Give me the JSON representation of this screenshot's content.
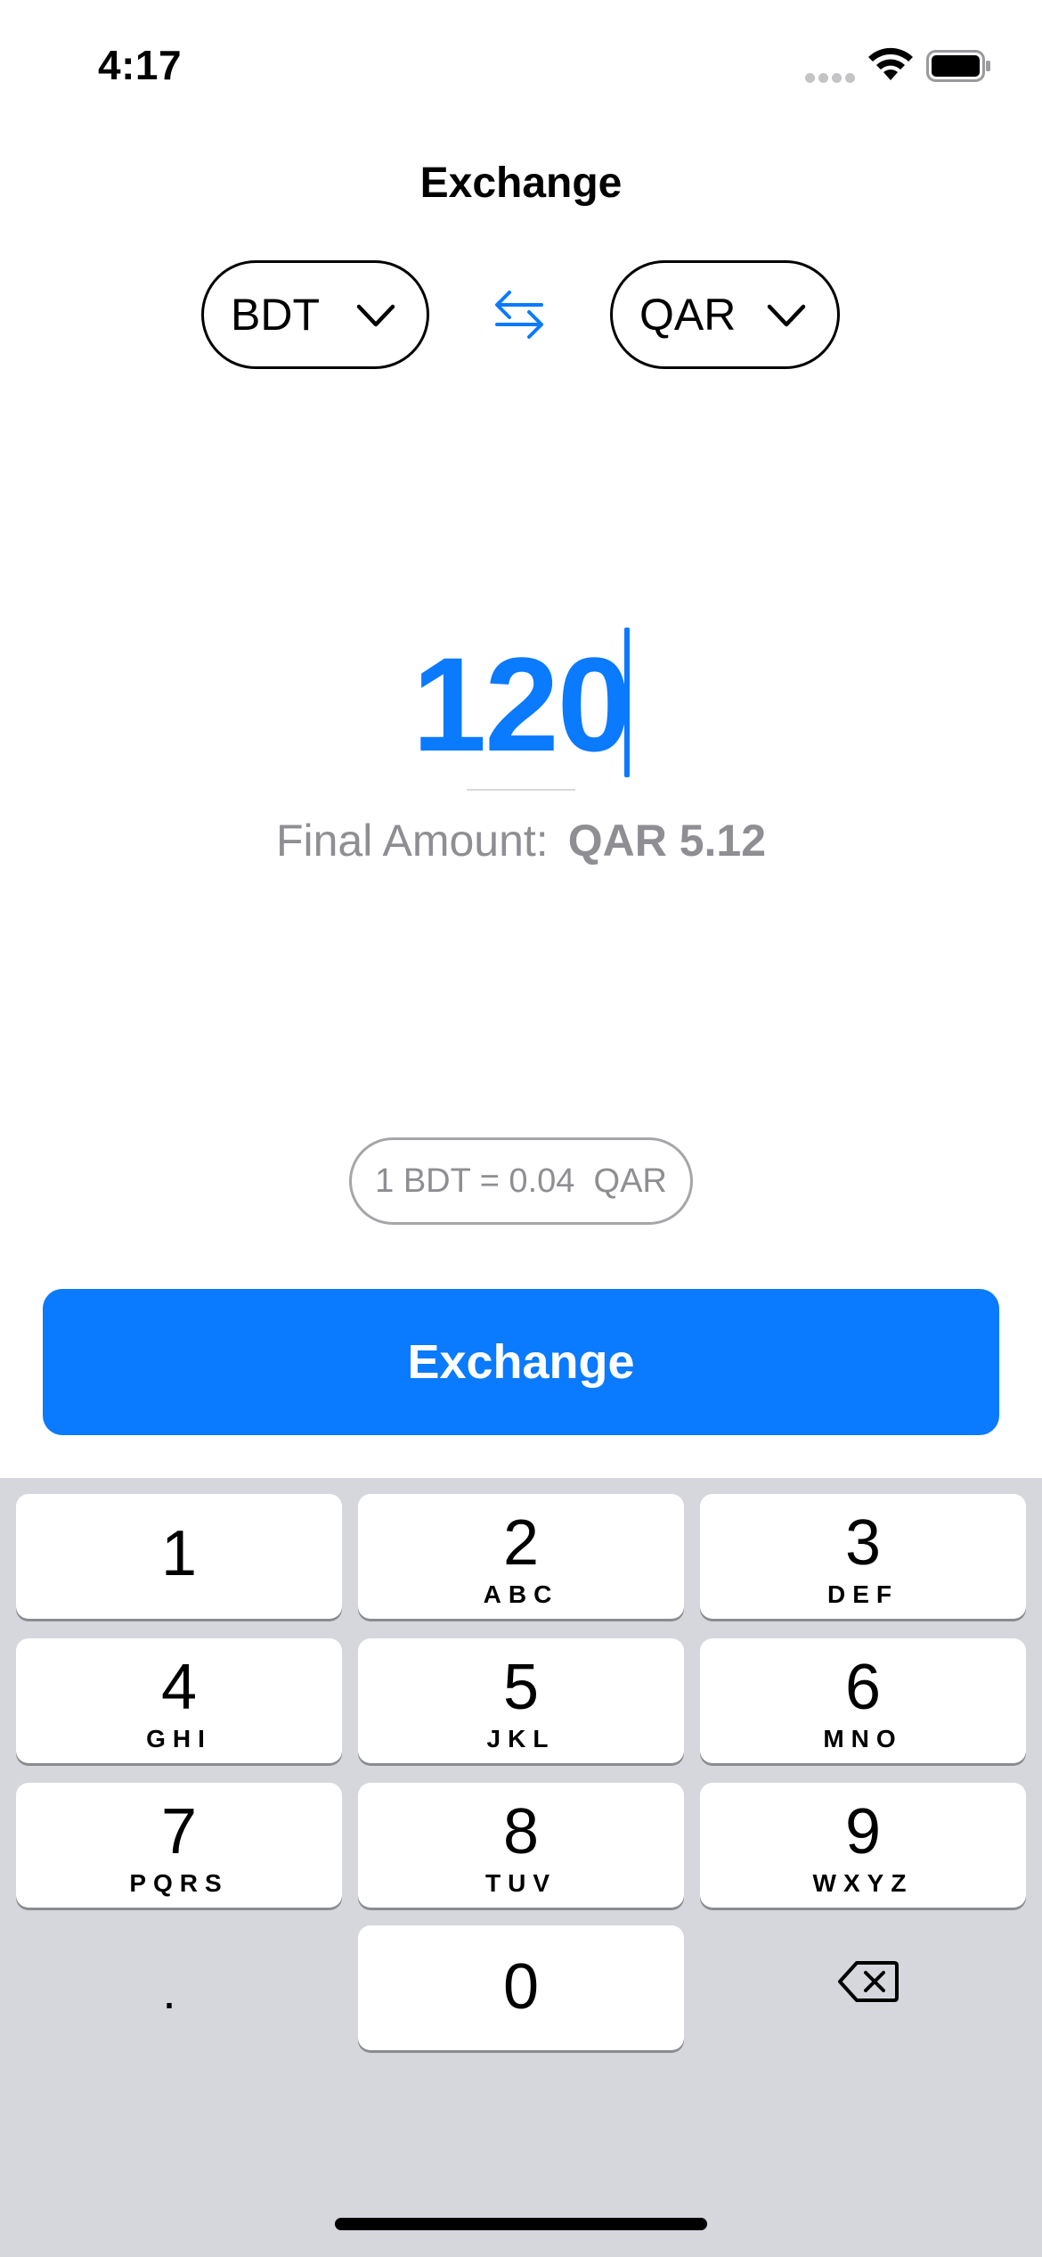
{
  "status_bar": {
    "time": "4:17",
    "icons": [
      "signal-dots-icon",
      "wifi-icon",
      "battery-icon"
    ]
  },
  "header": {
    "title": "Exchange"
  },
  "currency": {
    "from": "BDT",
    "to": "QAR",
    "swap_icon": "swap-arrows-icon",
    "dropdown_icon": "chevron-down-icon"
  },
  "amount": {
    "value": "120",
    "final_label": "Final Amount:",
    "final_value": "QAR 5.12"
  },
  "rate": {
    "text": "1 BDT = 0.04  QAR"
  },
  "actions": {
    "exchange_label": "Exchange"
  },
  "keyboard": {
    "keys": [
      {
        "digit": "1",
        "letters": ""
      },
      {
        "digit": "2",
        "letters": "ABC"
      },
      {
        "digit": "3",
        "letters": "DEF"
      },
      {
        "digit": "4",
        "letters": "GHI"
      },
      {
        "digit": "5",
        "letters": "JKL"
      },
      {
        "digit": "6",
        "letters": "MNO"
      },
      {
        "digit": "7",
        "letters": "PQRS"
      },
      {
        "digit": "8",
        "letters": "TUV"
      },
      {
        "digit": "9",
        "letters": "WXYZ"
      },
      {
        "digit": "0",
        "letters": ""
      }
    ],
    "decimal": ".",
    "delete_icon": "delete-backspace-icon"
  },
  "colors": {
    "accent": "#0a7aff",
    "secondary_text": "#8e8e93",
    "keyboard_bg": "#d5d7dc"
  }
}
